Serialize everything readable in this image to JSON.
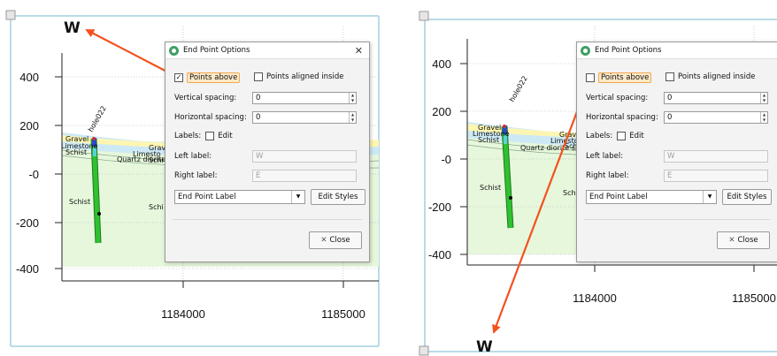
{
  "colors": {
    "border": "#b9dbe6",
    "arrow": "#f4511e",
    "gravel": "#fdf6b2",
    "limestone": "#cde9f5",
    "schist": "#e6f7dc",
    "drillhole": "#2fc12f"
  },
  "dialog": {
    "title": "End Point Options",
    "points_above_label": "Points above",
    "points_aligned_label": "Points aligned inside",
    "vertical_spacing_label": "Vertical spacing:",
    "vertical_spacing_value": "0",
    "horizontal_spacing_label": "Horizontal spacing:",
    "horizontal_spacing_value": "0",
    "labels_label": "Labels:",
    "edit_label": "Edit",
    "left_label_label": "Left label:",
    "left_label_value": "W",
    "right_label_label": "Right label:",
    "right_label_value": "E",
    "style_select_value": "End Point Label",
    "edit_styles_label": "Edit Styles",
    "close_label": "Close"
  },
  "panels": [
    {
      "end_point_label": "W",
      "points_above_checked": true,
      "points_above_mark": "✓",
      "y_ticks": [
        "400",
        "200",
        "-0",
        "-200",
        "-400"
      ],
      "x_ticks": [
        "1184000",
        "1185000"
      ],
      "hole_label": "hole022",
      "layer_labels": [
        "Gravel",
        "Limestone",
        "Schist",
        "Quartz diorite sill",
        "Schist",
        "Schi",
        "Grav",
        "Limesto",
        "Schi"
      ]
    },
    {
      "end_point_label": "W",
      "points_above_checked": false,
      "points_above_mark": "",
      "y_ticks": [
        "400",
        "200",
        "-0",
        "-200",
        "-400"
      ],
      "x_ticks": [
        "1184000",
        "1185000"
      ],
      "hole_label": "hole022",
      "layer_labels": [
        "Gravel",
        "Limestone",
        "Schist",
        "Quartz diorite sill",
        "Schist",
        "Schi",
        "Grav",
        "Limesto",
        "Schi"
      ]
    }
  ]
}
